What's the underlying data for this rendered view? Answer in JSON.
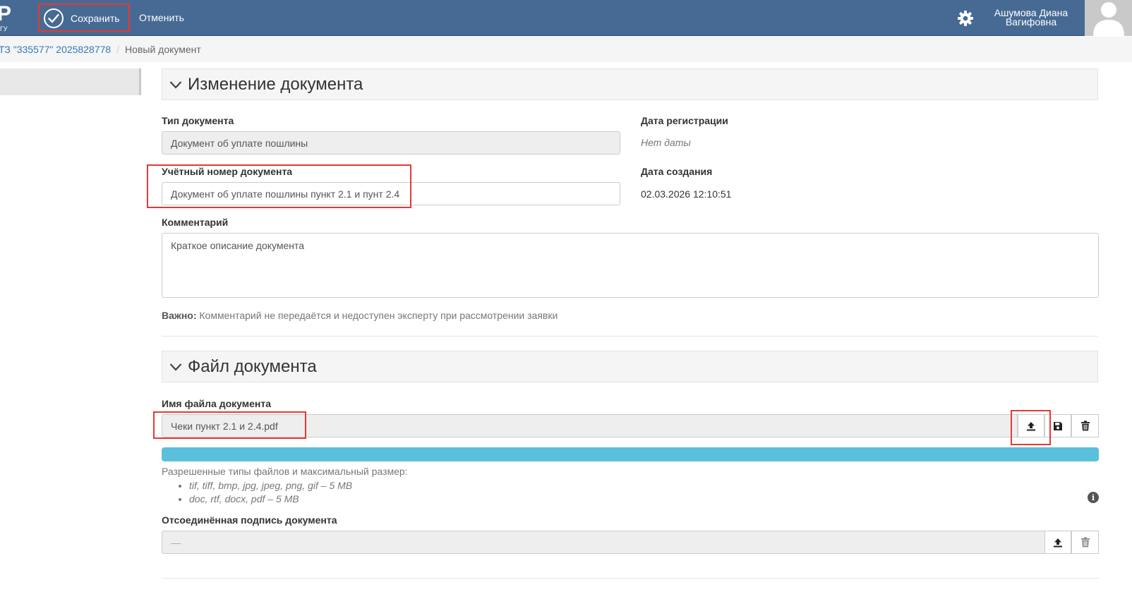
{
  "header": {
    "logo_big": "Р",
    "logo_small": "ГУ",
    "save_label": "Сохранить",
    "cancel_label": "Отменить",
    "user_name": "Ашумова Диана Вагифовна"
  },
  "breadcrumb": {
    "link": "ТЗ \"335577\" 2025828778",
    "separator": "/",
    "current": "Новый документ"
  },
  "section_edit": {
    "title": "Изменение документа",
    "doc_type_label": "Тип документа",
    "doc_type_value": "Документ об уплате пошлины",
    "reg_date_label": "Дата регистрации",
    "reg_date_value": "Нет даты",
    "account_number_label": "Учётный номер документа",
    "account_number_value": "Документ об уплате пошлины пункт 2.1 и пунт 2.4",
    "created_label": "Дата создания",
    "created_value": "02.03.2026 12:10:51",
    "comment_label": "Комментарий",
    "comment_value": "Краткое описание документа",
    "note_bold": "Важно:",
    "note_text": " Комментарий не передаётся и недоступен эксперту при рассмотрении заявки"
  },
  "section_file": {
    "title": "Файл документа",
    "file_name_label": "Имя файла документа",
    "file_name_value": "Чеки пункт 2.1 и 2.4.pdf",
    "upload_progress": 1.0,
    "allowed_title": "Разрешенные типы файлов и максимальный размер:",
    "allowed_types": [
      "tif, tiff, bmp, jpg, jpeg, png, gif – 5 MB",
      "doc, rtf, docx, pdf – 5 MB"
    ],
    "signature_label": "Отсоединённая подпись документа",
    "signature_value": "—"
  },
  "colors": {
    "header_bg": "#466a94",
    "progress": "#5bc0de",
    "link": "#337ab7",
    "highlight": "#e53935"
  }
}
